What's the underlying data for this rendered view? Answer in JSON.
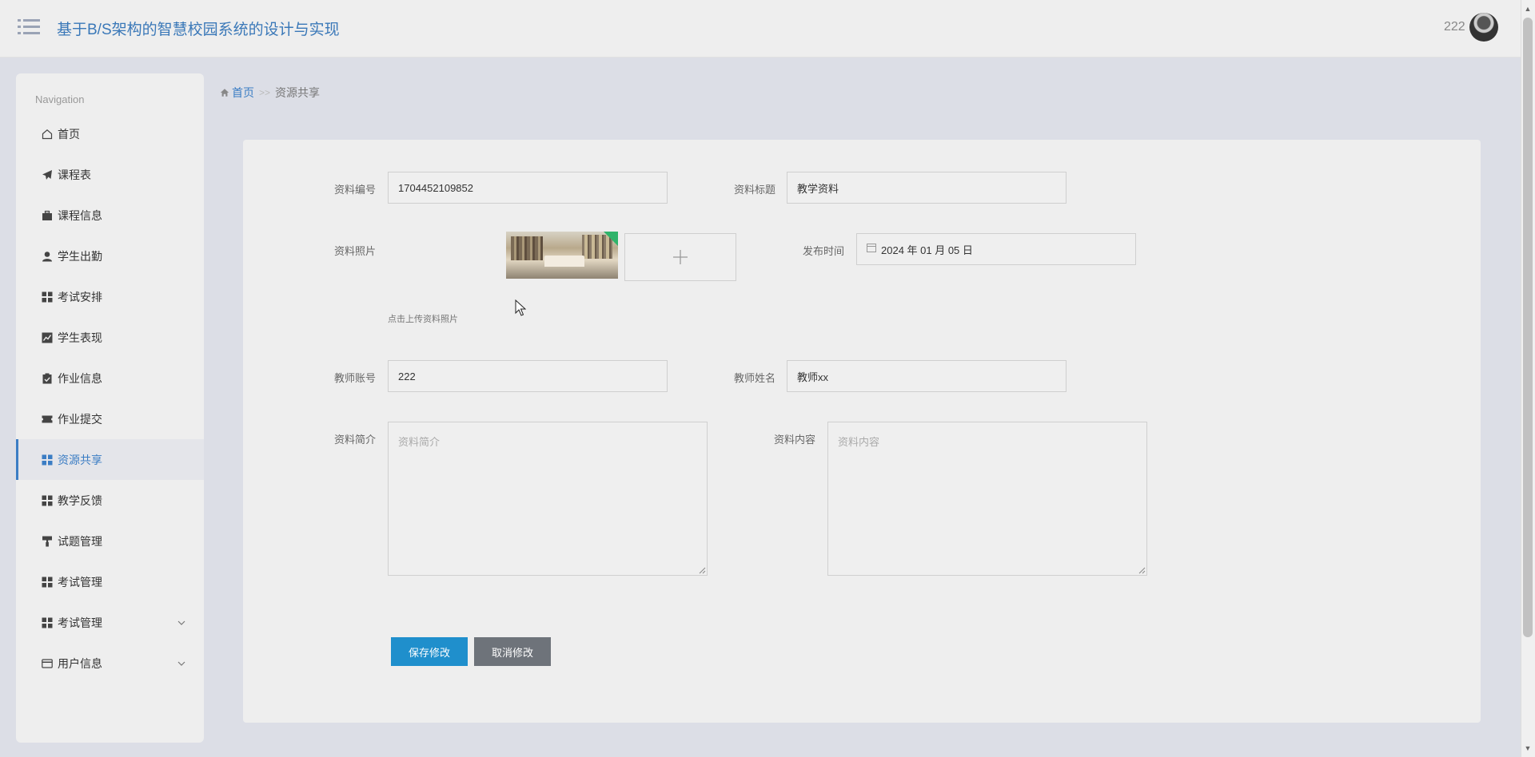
{
  "header": {
    "title": "基于B/S架构的智慧校园系统的设计与实现",
    "username": "222"
  },
  "sidebar": {
    "heading": "Navigation",
    "items": [
      {
        "label": "首页",
        "icon": "home-icon"
      },
      {
        "label": "课程表",
        "icon": "paper-plane-icon"
      },
      {
        "label": "课程信息",
        "icon": "briefcase-icon"
      },
      {
        "label": "学生出勤",
        "icon": "user-icon"
      },
      {
        "label": "考试安排",
        "icon": "grid-icon"
      },
      {
        "label": "学生表现",
        "icon": "line-chart-icon"
      },
      {
        "label": "作业信息",
        "icon": "clipboard-check-icon"
      },
      {
        "label": "作业提交",
        "icon": "ticket-icon"
      },
      {
        "label": "资源共享",
        "icon": "grid-icon",
        "active": true
      },
      {
        "label": "教学反馈",
        "icon": "grid-icon"
      },
      {
        "label": "试题管理",
        "icon": "paint-roller-icon"
      },
      {
        "label": "考试管理",
        "icon": "grid-icon"
      },
      {
        "label": "考试管理",
        "icon": "grid-icon",
        "expandable": true
      },
      {
        "label": "用户信息",
        "icon": "id-card-icon",
        "expandable": true
      }
    ]
  },
  "breadcrumb": {
    "home": "首页",
    "separator": ">>",
    "current": "资源共享"
  },
  "form": {
    "resource_no_label": "资料编号",
    "resource_no_value": "1704452109852",
    "resource_title_label": "资料标题",
    "resource_title_value": "教学资料",
    "photo_label": "资料照片",
    "upload_hint": "点击上传资料照片",
    "publish_time_label": "发布时间",
    "publish_time_value": "2024 年 01 月 05 日",
    "teacher_account_label": "教师账号",
    "teacher_account_value": "222",
    "teacher_name_label": "教师姓名",
    "teacher_name_value": "教师xx",
    "summary_label": "资料简介",
    "summary_placeholder": "资料简介",
    "content_label": "资料内容",
    "content_placeholder": "资料内容",
    "save_button": "保存修改",
    "cancel_button": "取消修改"
  },
  "colors": {
    "accent": "#3b7dc4",
    "save_button": "#1f8fcc",
    "cancel_button": "#6e737a"
  }
}
